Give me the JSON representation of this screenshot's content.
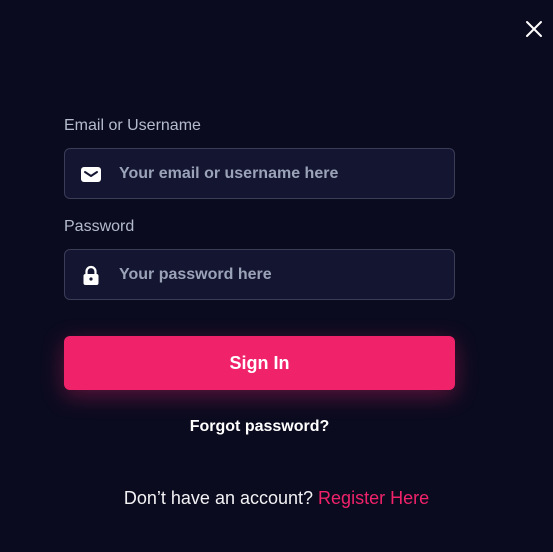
{
  "colors": {
    "background": "#0b0b1f",
    "input_background": "#141631",
    "input_border": "#3a3c58",
    "accent": "#f0226a",
    "label": "#b4bccc",
    "placeholder": "#9aa3b8"
  },
  "dialog": {
    "close_icon": "close-icon"
  },
  "email": {
    "label": "Email or Username",
    "placeholder": "Your email or username here",
    "value": "",
    "icon": "envelope-icon"
  },
  "password": {
    "label": "Password",
    "placeholder": "Your password here",
    "value": "",
    "icon": "lock-icon"
  },
  "signin": {
    "label": "Sign In"
  },
  "forgot": {
    "label": "Forgot password?"
  },
  "register": {
    "prompt": "Don’t have an account?",
    "link": "Register Here"
  }
}
